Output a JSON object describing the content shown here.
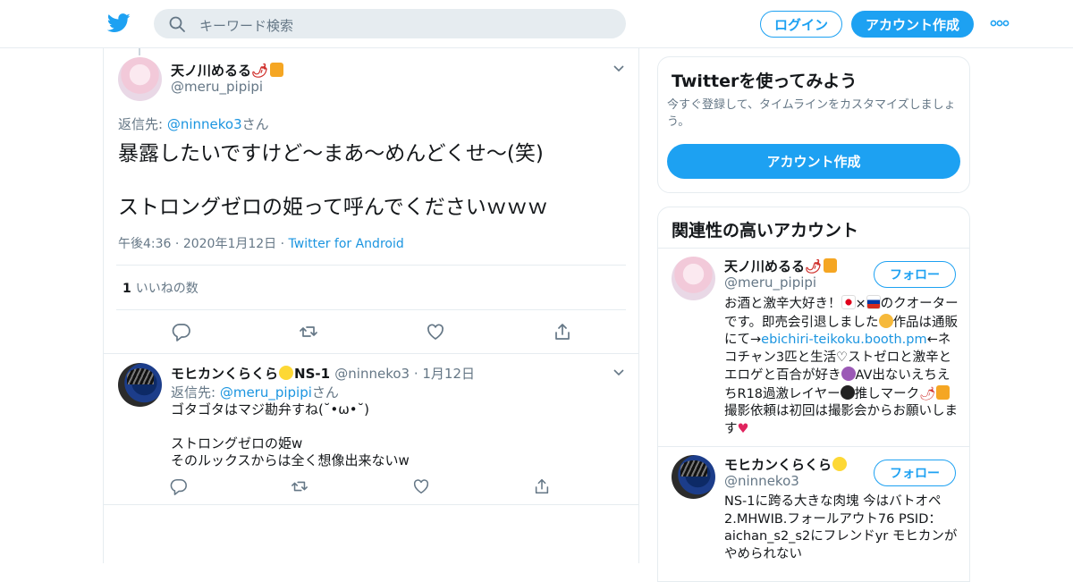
{
  "nav": {
    "search_placeholder": "キーワード検索",
    "login_label": "ログイン",
    "signup_label": "アカウント作成"
  },
  "tweet": {
    "display_name": "天ノ川めるる",
    "handle": "@meru_pipipi",
    "reply_prefix": "返信先: ",
    "reply_to": "@ninneko3",
    "reply_suffix": "さん",
    "line1": "暴露したいですけど～まあ～めんどくせ～(笑)",
    "line2": "ストロングゼロの姫って呼んでくださいｗｗｗ",
    "time": "午後4:36",
    "date": "2020年1月12日",
    "source": "Twitter for Android",
    "like_count": "1",
    "like_label": "いいねの数"
  },
  "reply": {
    "display_name": "モヒカンくらくら",
    "name_suffix": "NS-1",
    "handle": "@ninneko3",
    "date": "1月12日",
    "reply_prefix": "返信先: ",
    "reply_to": "@meru_pipipi",
    "reply_suffix": "さん",
    "text": "ゴタゴタはマジ勘弁すね(˘•ω•˘)\n\nストロングゼロの姫w\nそのルックスからは全く想像出来ないw"
  },
  "signup_card": {
    "title": "Twitterを使ってみよう",
    "subtitle": "今すぐ登録して、タイムラインをカスタマイズしましょう。",
    "button_label": "アカウント作成"
  },
  "related_card": {
    "title": "関連性の高いアカウント",
    "accounts": [
      {
        "display_name": "天ノ川めるる",
        "handle": "@meru_pipipi",
        "follow_label": "フォロー",
        "bio_1": "お酒と激辛大好き！",
        "bio_2": "×",
        "bio_3": "のクオーターです。即売会引退しました",
        "bio_4": "作品は通販にて→",
        "bio_link": "ebichiri-teikoku.booth.pm",
        "bio_5": "←ネコチャン3匹と生活♡ストゼロと激辛とエロゲと百合が好き",
        "bio_6": "AV出ないえちえちR18過激レイヤー",
        "bio_7": "推しマーク",
        "bio_8": "撮影依頼は初回は撮影会からお願いします"
      },
      {
        "display_name": "モヒカンくらくら",
        "handle": "@ninneko3",
        "follow_label": "フォロー",
        "bio": "NS-1に跨る大きな肉塊 今はバトオペ2.MHWIB.フォールアウト76 PSID：aichan_s2_s2にフレンドyr モヒカンがやめられない"
      }
    ]
  },
  "colors": {
    "brand": "#1da1f2",
    "link": "#1b95e0",
    "muted": "#657786",
    "border": "#e6ecf0"
  },
  "icons": [
    "twitter-bird-icon",
    "search-icon",
    "more-dots-icon",
    "chevron-down-icon",
    "reply-icon",
    "retweet-icon",
    "like-icon",
    "share-icon"
  ]
}
